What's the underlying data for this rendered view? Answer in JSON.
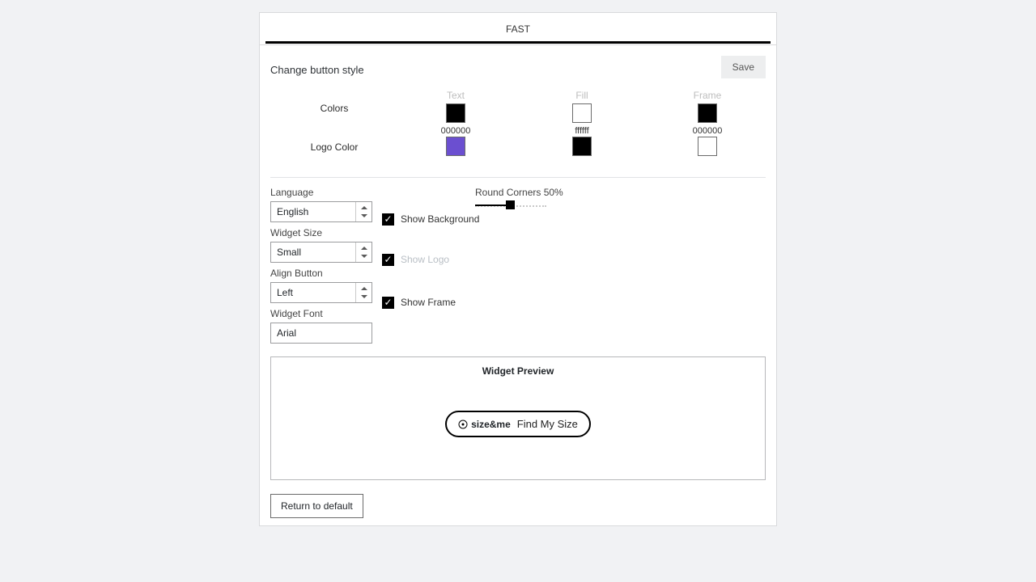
{
  "tab": {
    "label": "FAST"
  },
  "header": {
    "title": "Change button style",
    "save": "Save"
  },
  "colors": {
    "row_label": "Colors",
    "text": {
      "head": "Text",
      "hex": "000000",
      "swatch": "#000000"
    },
    "fill": {
      "head": "Fill",
      "hex": "ffffff",
      "swatch": "#ffffff"
    },
    "frame": {
      "head": "Frame",
      "hex": "000000",
      "swatch": "#000000"
    }
  },
  "logo": {
    "row_label": "Logo Color",
    "opts": [
      {
        "swatch": "#6b4fd0"
      },
      {
        "swatch": "#000000"
      },
      {
        "swatch": "#ffffff"
      }
    ]
  },
  "form": {
    "language": {
      "label": "Language",
      "value": "English"
    },
    "widget_size": {
      "label": "Widget Size",
      "value": "Small"
    },
    "align_button": {
      "label": "Align Button",
      "value": "Left"
    },
    "widget_font": {
      "label": "Widget Font",
      "value": "Arial"
    }
  },
  "checks": {
    "show_background": "Show Background",
    "show_logo": "Show Logo",
    "show_frame": "Show Frame"
  },
  "slider": {
    "label": "Round Corners 50%",
    "percent": 50
  },
  "preview": {
    "title": "Widget Preview",
    "brand": "size&me",
    "cta": "Find My Size"
  },
  "return_btn": "Return to default"
}
